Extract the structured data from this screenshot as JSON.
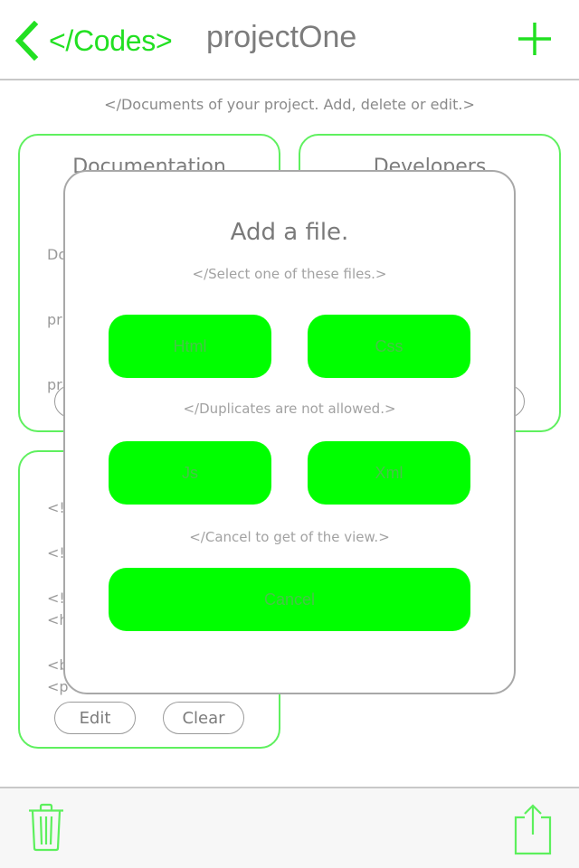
{
  "nav": {
    "back_label": "</Codes>",
    "title": "projectOne",
    "add_icon": "plus-icon",
    "back_icon": "chevron-left-icon"
  },
  "subtitle": "</Documents of your project. Add, delete or edit.>",
  "cards": [
    {
      "title": "Documentation",
      "body_lines": [
        "Do",
        "pr",
        "pr"
      ]
    },
    {
      "title": "Developers"
    },
    {
      "code_lines": [
        "<!",
        "<!",
        "<!",
        "<h",
        "<b",
        "<p"
      ],
      "edit_label": "Edit",
      "clear_label": "Clear"
    }
  ],
  "modal": {
    "title": "Add a file.",
    "hint_select": "</Select one of these files.>",
    "hint_duplicates": "</Duplicates are not allowed.>",
    "hint_cancel": "</Cancel to get of the view.>",
    "buttons": {
      "html": "Html",
      "css": "Css",
      "js": "Js",
      "xml": "Xml",
      "cancel": "Cancel"
    }
  },
  "toolbar": {
    "left_icon": "trash-icon",
    "right_icon": "share-icon"
  },
  "colors": {
    "accent": "#22e022",
    "button_fill": "#00ff00",
    "card_border": "#5ff05f",
    "text_gray": "#7c7c7c"
  }
}
